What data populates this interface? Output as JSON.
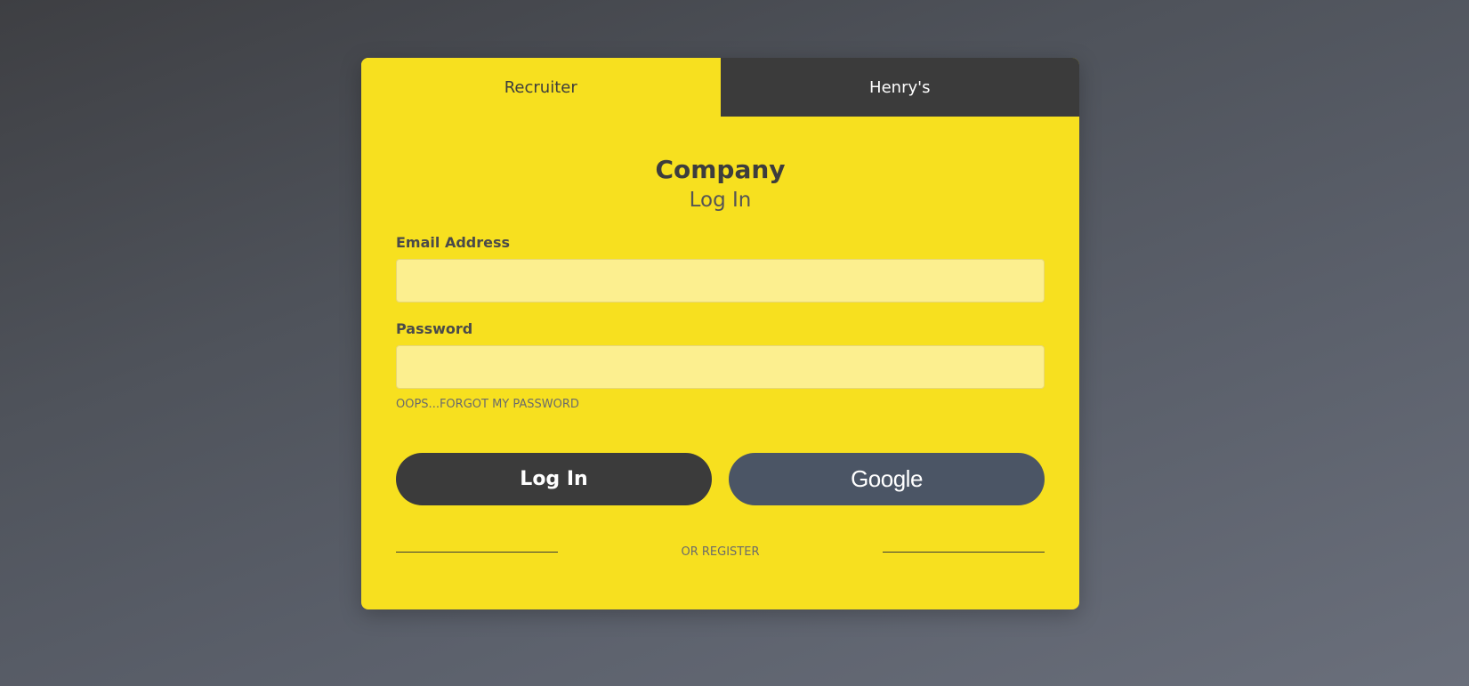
{
  "tabs": [
    {
      "label": "Recruiter",
      "active": true
    },
    {
      "label": "Henry's",
      "active": false
    }
  ],
  "form": {
    "title": "Company",
    "subtitle": "Log In",
    "email_label": "Email Address",
    "email_value": "",
    "password_label": "Password",
    "password_value": "",
    "forgot_link": "OOPS...FORGOT MY PASSWORD",
    "login_button": "Log In",
    "google_button": "Google",
    "register_text": "OR REGISTER"
  },
  "colors": {
    "card_bg": "#f7e01f",
    "input_bg": "#fcef8f",
    "dark_button": "#3b3b3b",
    "google_button": "#4b5565"
  }
}
